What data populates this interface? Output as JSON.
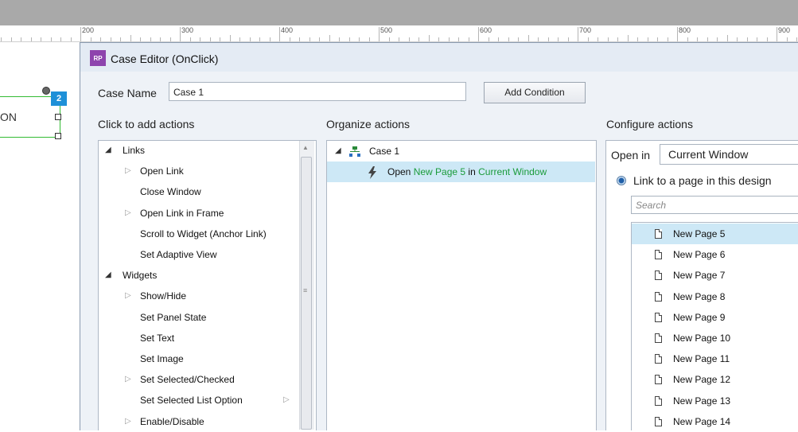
{
  "ruler": {
    "labels": [
      "200",
      "300",
      "400",
      "500",
      "600",
      "700",
      "800",
      "900"
    ]
  },
  "canvas": {
    "widget_text": "ON",
    "badge": "2"
  },
  "dialog": {
    "app_icon": "RP",
    "title": "Case Editor (OnClick)",
    "case_name_label": "Case Name",
    "case_name_value": "Case 1",
    "add_condition": "Add Condition",
    "click_to_add_label": "Click to add actions",
    "organize_label": "Organize actions",
    "configure_label": "Configure actions"
  },
  "actions": [
    {
      "label": "Links",
      "level": 0,
      "expander": "down"
    },
    {
      "label": "Open Link",
      "level": 1,
      "expander": "right"
    },
    {
      "label": "Close Window",
      "level": 1,
      "expander": ""
    },
    {
      "label": "Open Link in Frame",
      "level": 1,
      "expander": "right"
    },
    {
      "label": "Scroll to Widget (Anchor Link)",
      "level": 1,
      "expander": ""
    },
    {
      "label": "Set Adaptive View",
      "level": 1,
      "expander": ""
    },
    {
      "label": "Widgets",
      "level": 0,
      "expander": "down"
    },
    {
      "label": "Show/Hide",
      "level": 1,
      "expander": "right"
    },
    {
      "label": "Set Panel State",
      "level": 1,
      "expander": ""
    },
    {
      "label": "Set Text",
      "level": 1,
      "expander": ""
    },
    {
      "label": "Set Image",
      "level": 1,
      "expander": ""
    },
    {
      "label": "Set Selected/Checked",
      "level": 1,
      "expander": "right"
    },
    {
      "label": "Set Selected List Option",
      "level": 1,
      "expander": "",
      "submenu": "right"
    },
    {
      "label": "Enable/Disable",
      "level": 1,
      "expander": "right"
    }
  ],
  "organize": {
    "case_label": "Case 1",
    "action": {
      "verb": "Open",
      "page": "New Page 5",
      "in": "in",
      "target": "Current Window"
    }
  },
  "configure": {
    "open_in_label": "Open in",
    "open_in_value": "Current Window",
    "link_option": "Link to a page in this design",
    "search_placeholder": "Search",
    "pages": [
      "New Page 5",
      "New Page 6",
      "New Page 7",
      "New Page 8",
      "New Page 9",
      "New Page 10",
      "New Page 11",
      "New Page 12",
      "New Page 13",
      "New Page 14"
    ],
    "selected_page": "New Page 5"
  },
  "colors": {
    "accent_green": "#1a9b3a",
    "selection": "#cde8f6",
    "badge": "#1e90d8",
    "app_icon": "#8e44ad"
  }
}
